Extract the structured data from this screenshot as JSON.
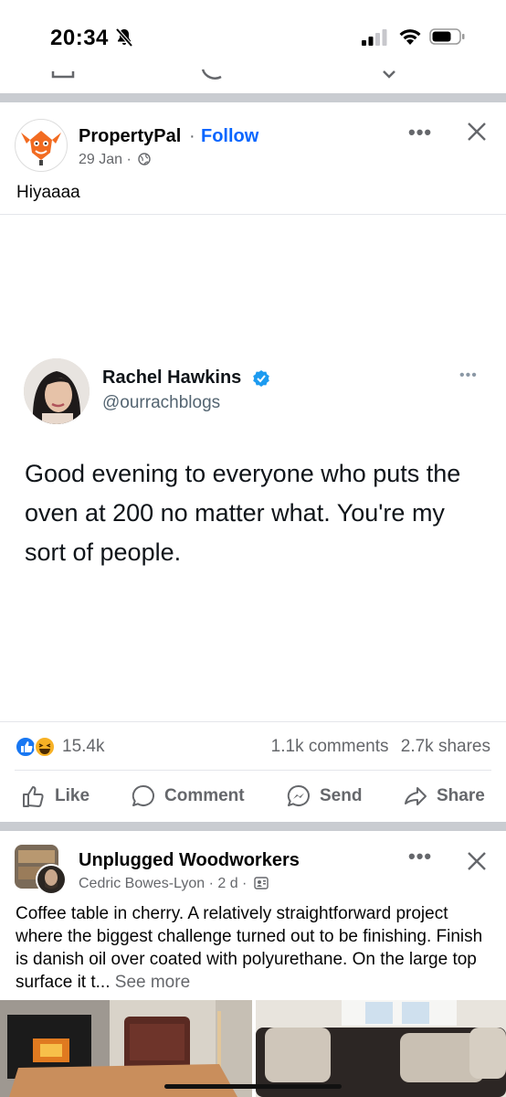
{
  "status": {
    "time": "20:34"
  },
  "post1": {
    "page_name": "PropertyPal",
    "separator": "·",
    "follow_label": "Follow",
    "date": "29 Jan ·",
    "caption": "Hiyaaaa",
    "tweet": {
      "name": "Rachel Hawkins",
      "handle": "@ourrachblogs",
      "text": "Good evening to everyone who puts the oven at 200 no matter what. You're my sort of people."
    },
    "reaction_count": "15.4k",
    "comments": "1.1k comments",
    "shares": "2.7k shares",
    "actions": [
      "Like",
      "Comment",
      "Send",
      "Share"
    ]
  },
  "post2": {
    "group_name": "Unplugged Woodworkers",
    "author_meta": "Cedric Bowes-Lyon · 2 d ·",
    "text": "Coffee table in cherry. A relatively straightforward project where the biggest challenge turned out to be finishing. Finish is danish oil over coated with polyurethane. On the large top surface it t...",
    "see_more": "See more"
  },
  "colors": {
    "accent": "#0866ff",
    "muted": "#65676b",
    "separator": "#c9ccd1"
  },
  "icons": [
    "bell-slash-icon",
    "signal-icon",
    "wifi-icon",
    "battery-icon",
    "more-icon",
    "close-icon",
    "globe-icon",
    "verified-icon",
    "like-reaction-icon",
    "haha-reaction-icon",
    "like-icon",
    "comment-icon",
    "send-icon",
    "share-icon",
    "group-icon"
  ]
}
